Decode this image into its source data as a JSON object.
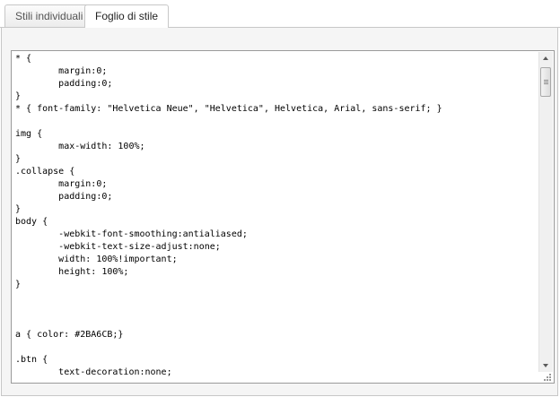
{
  "tabs": [
    {
      "label": "Stili individuali",
      "active": false
    },
    {
      "label": "Foglio di stile",
      "active": true
    }
  ],
  "editor": {
    "code": "* {\n\tmargin:0;\n\tpadding:0;\n}\n* { font-family: \"Helvetica Neue\", \"Helvetica\", Helvetica, Arial, sans-serif; }\n\nimg {\n\tmax-width: 100%;\n}\n.collapse {\n\tmargin:0;\n\tpadding:0;\n}\nbody {\n\t-webkit-font-smoothing:antialiased;\n\t-webkit-text-size-adjust:none;\n\twidth: 100%!important;\n\theight: 100%;\n}\n\n\n\na { color: #2BA6CB;}\n\n.btn {\n\ttext-decoration:none;"
  },
  "icons": {
    "scroll_up": "arrow-up-icon",
    "scroll_down": "arrow-down-icon",
    "resize": "resize-grip-icon"
  }
}
